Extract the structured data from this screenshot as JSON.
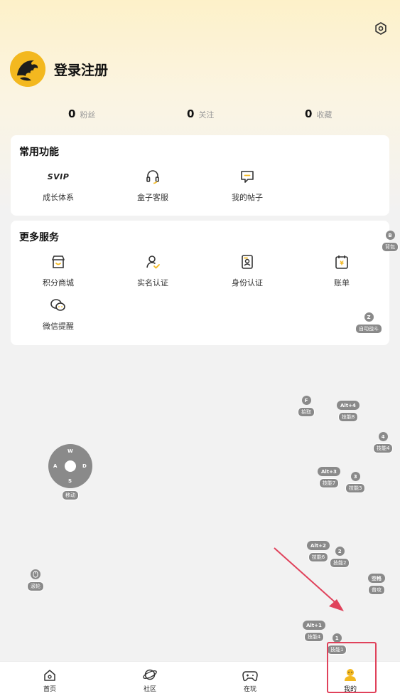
{
  "header": {
    "login_label": "登录注册"
  },
  "stats": [
    {
      "num": "0",
      "label": "粉丝"
    },
    {
      "num": "0",
      "label": "关注"
    },
    {
      "num": "0",
      "label": "收藏"
    }
  ],
  "common": {
    "title": "常用功能",
    "items": [
      {
        "label": "成长体系",
        "icon": "svip-icon",
        "badge": "SVIP"
      },
      {
        "label": "盒子客服",
        "icon": "headset-icon"
      },
      {
        "label": "我的帖子",
        "icon": "post-icon"
      }
    ]
  },
  "more": {
    "title": "更多服务",
    "items": [
      {
        "label": "积分商城",
        "icon": "shop-icon"
      },
      {
        "label": "实名认证",
        "icon": "user-verify-icon"
      },
      {
        "label": "身份认证",
        "icon": "id-card-icon"
      },
      {
        "label": "账单",
        "icon": "bill-icon"
      },
      {
        "label": "微信提醒",
        "icon": "wechat-icon"
      }
    ]
  },
  "overlay_keys": [
    {
      "cap": "B",
      "tag": "背包"
    },
    {
      "cap": "Z",
      "tag": "自动战斗"
    },
    {
      "cap": "F",
      "tag": "拾取"
    },
    {
      "cap": "Alt+4",
      "tag": "技能8"
    },
    {
      "cap": "4",
      "tag": "技能4"
    },
    {
      "cap": "Alt+3",
      "tag": "技能7"
    },
    {
      "cap": "3",
      "tag": "技能3"
    },
    {
      "cap": "Alt+2",
      "tag": "技能6"
    },
    {
      "cap": "2",
      "tag": "技能2"
    },
    {
      "cap": "空格",
      "tag": "普攻"
    },
    {
      "cap": "Alt+1",
      "tag": "技能4"
    },
    {
      "cap": "1",
      "tag": "技能1"
    }
  ],
  "dpad": {
    "up": "W",
    "left": "A",
    "right": "D",
    "down": "S",
    "tag": "移动"
  },
  "wheel": {
    "tag": "滚轮"
  },
  "nav": [
    {
      "label": "首页",
      "icon": "home-icon"
    },
    {
      "label": "社区",
      "icon": "planet-icon"
    },
    {
      "label": "在玩",
      "icon": "gamepad-icon"
    },
    {
      "label": "我的",
      "icon": "profile-icon"
    }
  ],
  "colors": {
    "accent": "#f3b81f",
    "overlay_key": "#8a8a8a",
    "highlight": "#e0425b"
  }
}
